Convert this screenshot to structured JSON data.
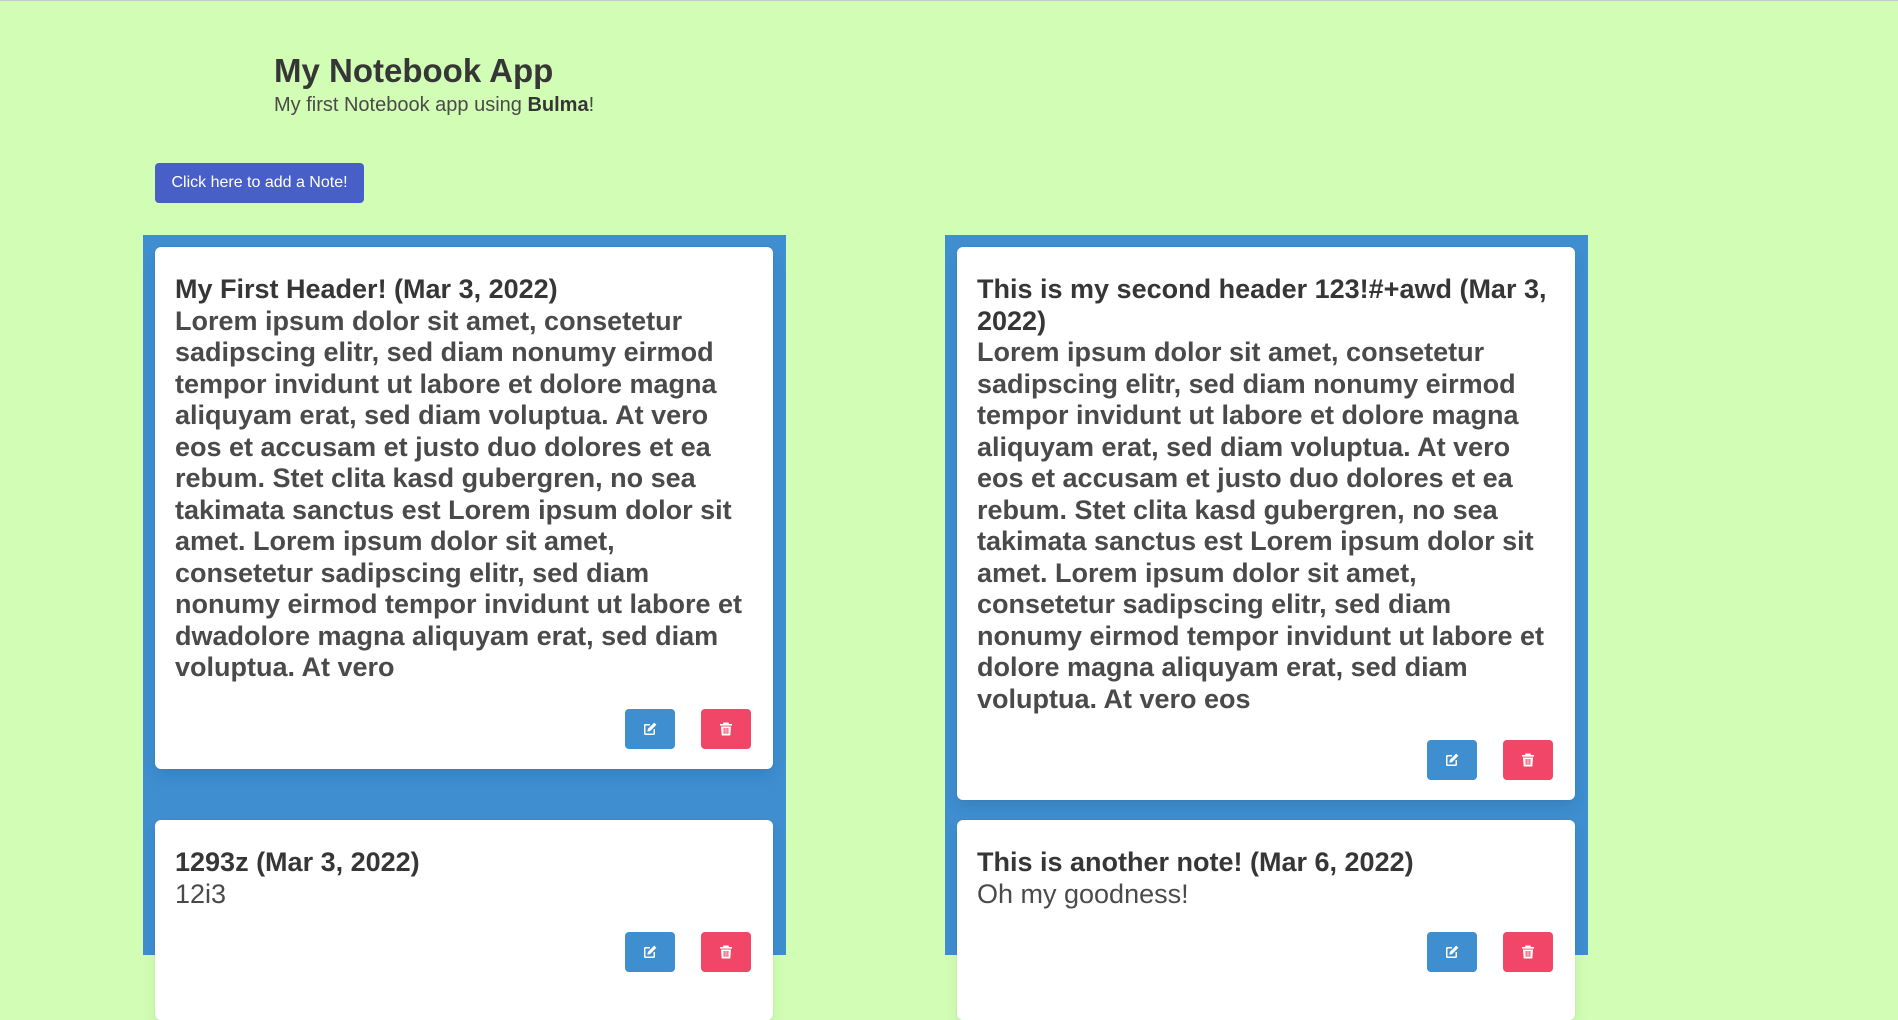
{
  "header": {
    "title": "My Notebook App",
    "subtitle_prefix": "My first Notebook app using ",
    "subtitle_brand": "Bulma",
    "subtitle_suffix": "!"
  },
  "add_button_label": "Click here to add a Note!",
  "colors": {
    "background": "#d1feb4",
    "column": "#3e8ed0",
    "primary_button": "#485fc7",
    "edit_button": "#3e8ed0",
    "delete_button": "#f14668"
  },
  "notes": [
    {
      "title": "My First Header! (Mar 3, 2022)",
      "body": "Lorem ipsum dolor sit amet, consetetur sadipscing elitr, sed diam nonumy eirmod tempor invidunt ut labore et dolore magna aliquyam erat, sed diam voluptua. At vero eos et accusam et justo duo dolores et ea rebum. Stet clita kasd gubergren, no sea takimata sanctus est Lorem ipsum dolor sit amet. Lorem ipsum dolor sit amet, consetetur sadipscing elitr, sed diam nonumy eirmod tempor invidunt ut labore et dwadolore magna aliquyam erat, sed diam voluptua. At vero",
      "edit_icon": "edit-icon",
      "delete_icon": "trash-icon"
    },
    {
      "title": "This is my second header 123!#+awd (Mar 3, 2022)",
      "body": "Lorem ipsum dolor sit amet, consetetur sadipscing elitr, sed diam nonumy eirmod tempor invidunt ut labore et dolore magna aliquyam erat, sed diam voluptua. At vero eos et accusam et justo duo dolores et ea rebum. Stet clita kasd gubergren, no sea takimata sanctus est Lorem ipsum dolor sit amet. Lorem ipsum dolor sit amet, consetetur sadipscing elitr, sed diam nonumy eirmod tempor invidunt ut labore et dolore magna aliquyam erat, sed diam voluptua. At vero eos",
      "edit_icon": "edit-icon",
      "delete_icon": "trash-icon"
    },
    {
      "title": "1293z (Mar 3, 2022)",
      "body": "12i3",
      "edit_icon": "edit-icon",
      "delete_icon": "trash-icon"
    },
    {
      "title": "This is another note! (Mar 6, 2022)",
      "body": "Oh my goodness!",
      "edit_icon": "edit-icon",
      "delete_icon": "trash-icon"
    }
  ]
}
